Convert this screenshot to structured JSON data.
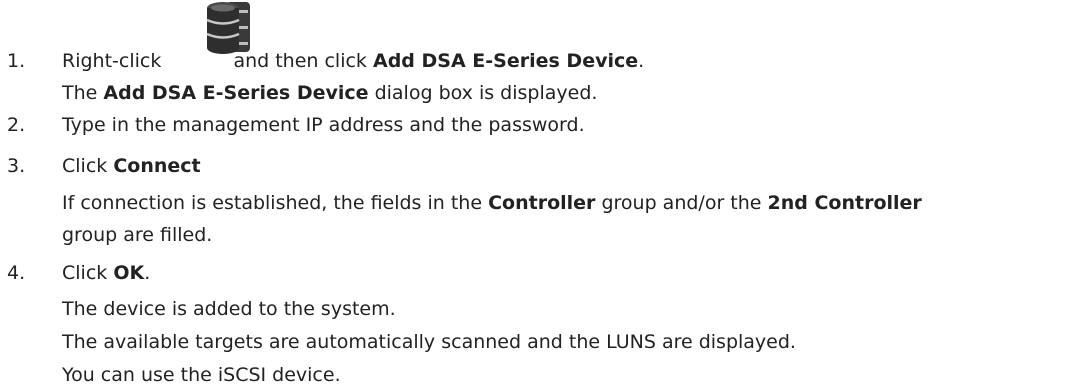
{
  "steps": [
    {
      "number": "1.",
      "lines": [
        {
          "parts": [
            "Right-click",
            "and then click",
            "Add DSA E-Series Device",
            "."
          ],
          "icon": "storage-drives-icon"
        },
        {
          "parts": [
            "The",
            "Add DSA E-Series Device",
            "dialog box is displayed."
          ]
        }
      ]
    },
    {
      "number": "2.",
      "lines": [
        {
          "parts": [
            "Type in the management IP address and the password."
          ]
        }
      ]
    },
    {
      "number": "3.",
      "lines": [
        {
          "parts": [
            "Click",
            "Connect"
          ]
        },
        {
          "parts": [
            "If connection is established, the fields in the",
            "Controller",
            "group and/or the",
            "2nd Controller"
          ]
        },
        {
          "parts": [
            "group are filled."
          ]
        }
      ]
    },
    {
      "number": "4.",
      "lines": [
        {
          "parts": [
            "Click",
            "OK",
            "."
          ]
        },
        {
          "parts": [
            "The device is added to the system."
          ]
        },
        {
          "parts": [
            "The available targets are automatically scanned and the LUNS are displayed."
          ]
        },
        {
          "parts": [
            "You can use the iSCSI device."
          ]
        }
      ]
    }
  ]
}
